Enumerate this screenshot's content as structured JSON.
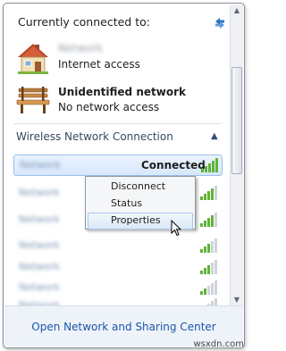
{
  "header": {
    "title": "Currently connected to:",
    "refresh_icon": "refresh-icon"
  },
  "connections": [
    {
      "name": "Network",
      "name_blurred": true,
      "status": "Internet access",
      "icon": "house-icon"
    },
    {
      "name": "Unidentified network",
      "name_blurred": false,
      "status": "No network access",
      "icon": "bench-icon"
    }
  ],
  "wireless": {
    "section_title": "Wireless Network Connection",
    "collapse_icon": "chevron-up-icon",
    "networks": [
      {
        "name": "Network",
        "status": "Connected",
        "selected": true
      },
      {
        "name": "Network",
        "status": ""
      },
      {
        "name": "Network",
        "status": ""
      },
      {
        "name": "Network",
        "status": ""
      },
      {
        "name": "Network",
        "status": ""
      },
      {
        "name": "Network",
        "status": ""
      },
      {
        "name": "Network",
        "status": ""
      }
    ]
  },
  "context_menu": {
    "items": [
      "Disconnect",
      "Status",
      "Properties"
    ],
    "hovered": "Properties"
  },
  "footer": {
    "link": "Open Network and Sharing Center"
  },
  "watermark": "wsxdn.com"
}
